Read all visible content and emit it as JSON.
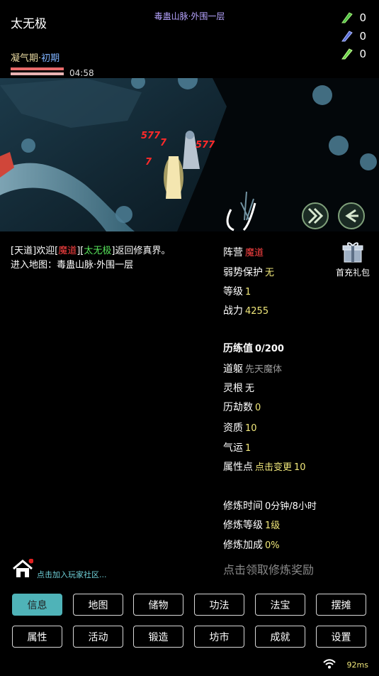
{
  "header": {
    "player_name": "太无极",
    "location": "毒蛊山脉·外围一层",
    "realm_main": "凝气期",
    "realm_dot": "·",
    "realm_stage": "初期",
    "timer": "04:58"
  },
  "resources": [
    {
      "icon": "green-gem-icon",
      "color": "#4fc24a",
      "count": "0"
    },
    {
      "icon": "blue-gem-icon",
      "color": "#5a6fd8",
      "count": "0"
    },
    {
      "icon": "green-leaf-gem-icon",
      "color": "#6bd34a",
      "count": "0"
    }
  ],
  "bars": {
    "hp_color": "#e86a6a",
    "mp_color": "#e8b2b2",
    "hp": 1.0,
    "mp": 1.0
  },
  "battle": {
    "damage": [
      "577",
      "7",
      "577",
      "7"
    ]
  },
  "chat": {
    "line1": {
      "p1": "[天道]欢迎[",
      "faction": "魔道",
      "p2": "][",
      "name": "太无极",
      "p3": "]返回修真界。"
    },
    "line2": "进入地图：毒蛊山脉·外围一层"
  },
  "gift": {
    "label": "首充礼包"
  },
  "stats": {
    "faction": {
      "label": "阵营",
      "value": "魔道"
    },
    "protection": {
      "label": "弱势保护",
      "value": "无"
    },
    "level": {
      "label": "等级",
      "value": "1"
    },
    "power": {
      "label": "战力",
      "value": "4255"
    },
    "exp": {
      "label": "历练值",
      "value": "0/200"
    },
    "body": {
      "label": "道躯",
      "value": "先天魔体"
    },
    "root": {
      "label": "灵根",
      "value": "无"
    },
    "tribulation": {
      "label": "历劫数",
      "value": "0"
    },
    "aptitude": {
      "label": "资质",
      "value": "10"
    },
    "luck": {
      "label": "气运",
      "value": "1"
    },
    "points": {
      "label": "属性点",
      "action": "点击变更",
      "value": "10"
    },
    "cult_time": {
      "label": "修炼时间",
      "value": "0分钟/8小时"
    },
    "cult_level": {
      "label": "修炼等级",
      "value": "1级"
    },
    "cult_bonus": {
      "label": "修炼加成",
      "value": "0%"
    },
    "claim": "点击领取修炼奖励"
  },
  "community": {
    "label": "点击加入玩家社区..."
  },
  "menu": {
    "row1": [
      "信息",
      "地图",
      "储物",
      "功法",
      "法宝",
      "摆摊"
    ],
    "row2": [
      "属性",
      "活动",
      "锻造",
      "坊市",
      "成就",
      "设置"
    ]
  },
  "status": {
    "ping": "92ms"
  }
}
